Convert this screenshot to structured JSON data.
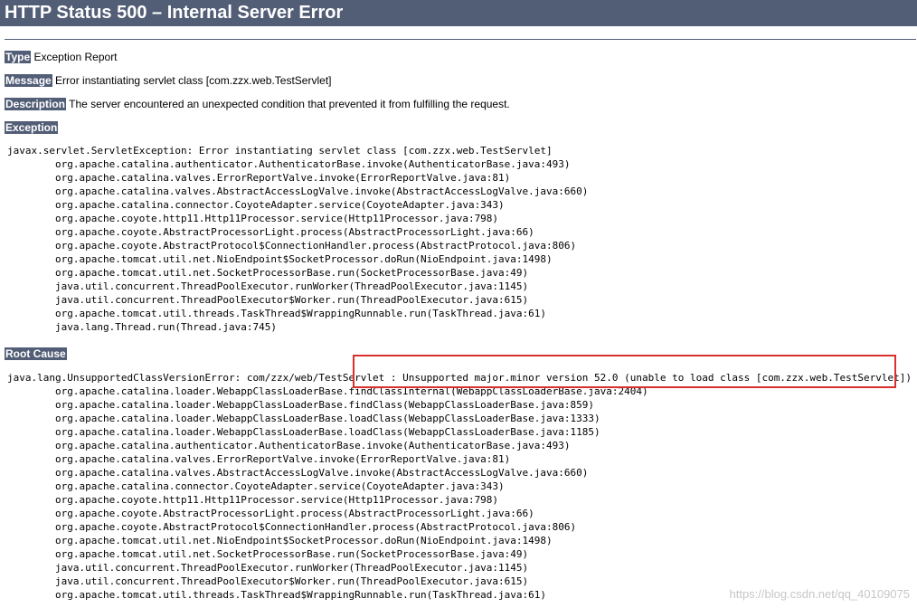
{
  "page_title": "HTTP Status 500 – Internal Server Error",
  "type_label": "Type",
  "type_value": "Exception Report",
  "message_label": "Message",
  "message_value": "Error instantiating servlet class [com.zzx.web.TestServlet]",
  "description_label": "Description",
  "description_value": "The server encountered an unexpected condition that prevented it from fulfilling the request.",
  "exception_label": "Exception",
  "exception_trace": "javax.servlet.ServletException: Error instantiating servlet class [com.zzx.web.TestServlet]\n\torg.apache.catalina.authenticator.AuthenticatorBase.invoke(AuthenticatorBase.java:493)\n\torg.apache.catalina.valves.ErrorReportValve.invoke(ErrorReportValve.java:81)\n\torg.apache.catalina.valves.AbstractAccessLogValve.invoke(AbstractAccessLogValve.java:660)\n\torg.apache.catalina.connector.CoyoteAdapter.service(CoyoteAdapter.java:343)\n\torg.apache.coyote.http11.Http11Processor.service(Http11Processor.java:798)\n\torg.apache.coyote.AbstractProcessorLight.process(AbstractProcessorLight.java:66)\n\torg.apache.coyote.AbstractProtocol$ConnectionHandler.process(AbstractProtocol.java:806)\n\torg.apache.tomcat.util.net.NioEndpoint$SocketProcessor.doRun(NioEndpoint.java:1498)\n\torg.apache.tomcat.util.net.SocketProcessorBase.run(SocketProcessorBase.java:49)\n\tjava.util.concurrent.ThreadPoolExecutor.runWorker(ThreadPoolExecutor.java:1145)\n\tjava.util.concurrent.ThreadPoolExecutor$Worker.run(ThreadPoolExecutor.java:615)\n\torg.apache.tomcat.util.threads.TaskThread$WrappingRunnable.run(TaskThread.java:61)\n\tjava.lang.Thread.run(Thread.java:745)",
  "root_cause_label": "Root Cause",
  "root_cause_trace": "java.lang.UnsupportedClassVersionError: com/zzx/web/TestServlet : Unsupported major.minor version 52.0 (unable to load class [com.zzx.web.TestServlet])\n\torg.apache.catalina.loader.WebappClassLoaderBase.findClassInternal(WebappClassLoaderBase.java:2404)\n\torg.apache.catalina.loader.WebappClassLoaderBase.findClass(WebappClassLoaderBase.java:859)\n\torg.apache.catalina.loader.WebappClassLoaderBase.loadClass(WebappClassLoaderBase.java:1333)\n\torg.apache.catalina.loader.WebappClassLoaderBase.loadClass(WebappClassLoaderBase.java:1185)\n\torg.apache.catalina.authenticator.AuthenticatorBase.invoke(AuthenticatorBase.java:493)\n\torg.apache.catalina.valves.ErrorReportValve.invoke(ErrorReportValve.java:81)\n\torg.apache.catalina.valves.AbstractAccessLogValve.invoke(AbstractAccessLogValve.java:660)\n\torg.apache.catalina.connector.CoyoteAdapter.service(CoyoteAdapter.java:343)\n\torg.apache.coyote.http11.Http11Processor.service(Http11Processor.java:798)\n\torg.apache.coyote.AbstractProcessorLight.process(AbstractProcessorLight.java:66)\n\torg.apache.coyote.AbstractProtocol$ConnectionHandler.process(AbstractProtocol.java:806)\n\torg.apache.tomcat.util.net.NioEndpoint$SocketProcessor.doRun(NioEndpoint.java:1498)\n\torg.apache.tomcat.util.net.SocketProcessorBase.run(SocketProcessorBase.java:49)\n\tjava.util.concurrent.ThreadPoolExecutor.runWorker(ThreadPoolExecutor.java:1145)\n\tjava.util.concurrent.ThreadPoolExecutor$Worker.run(ThreadPoolExecutor.java:615)\n\torg.apache.tomcat.util.threads.TaskThread$WrappingRunnable.run(TaskThread.java:61)",
  "watermark": "https://blog.csdn.net/qq_40109075",
  "colors": {
    "header_bg": "#525d76",
    "highlight_border": "#d9302c"
  }
}
